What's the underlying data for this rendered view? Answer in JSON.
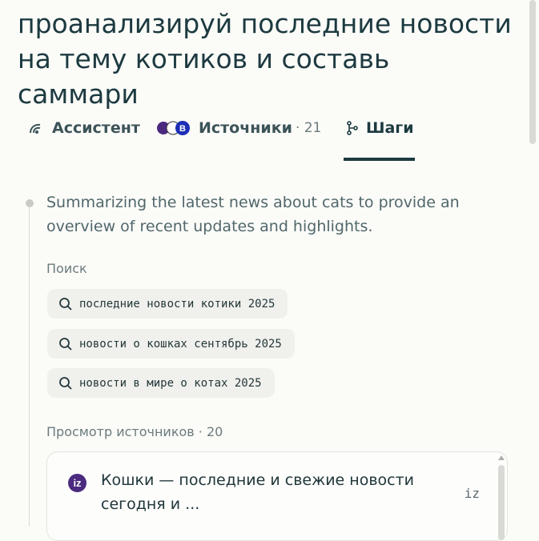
{
  "query_title": "проанализируй последние новости на тему котиков и составь саммари",
  "tabs": {
    "assistant": {
      "label": "Ассистент",
      "icon": "perplexity-swirl-icon"
    },
    "sources": {
      "label": "Источники",
      "count": "· 21",
      "icon": "source-favicons-icon"
    },
    "steps": {
      "label": "Шаги",
      "icon": "branch-icon",
      "active": true
    }
  },
  "steps": {
    "summary": "Summarizing the latest news about cats to provide an overview of recent updates and highlights.",
    "search_label": "Поиск",
    "queries": [
      "последние новости котики 2025",
      "новости о кошках сентябрь 2025",
      "новости в мире о котах 2025"
    ],
    "browse_label": "Просмотр источников · 20"
  },
  "source_card": {
    "logo_text": "iz",
    "headline": "Кошки — последние и свежие новости сегодня и ...",
    "domain": "iz"
  },
  "colors": {
    "accent": "#1c3a40",
    "chip_bg": "#f0f0ec",
    "logo": "#4b2a7f"
  }
}
